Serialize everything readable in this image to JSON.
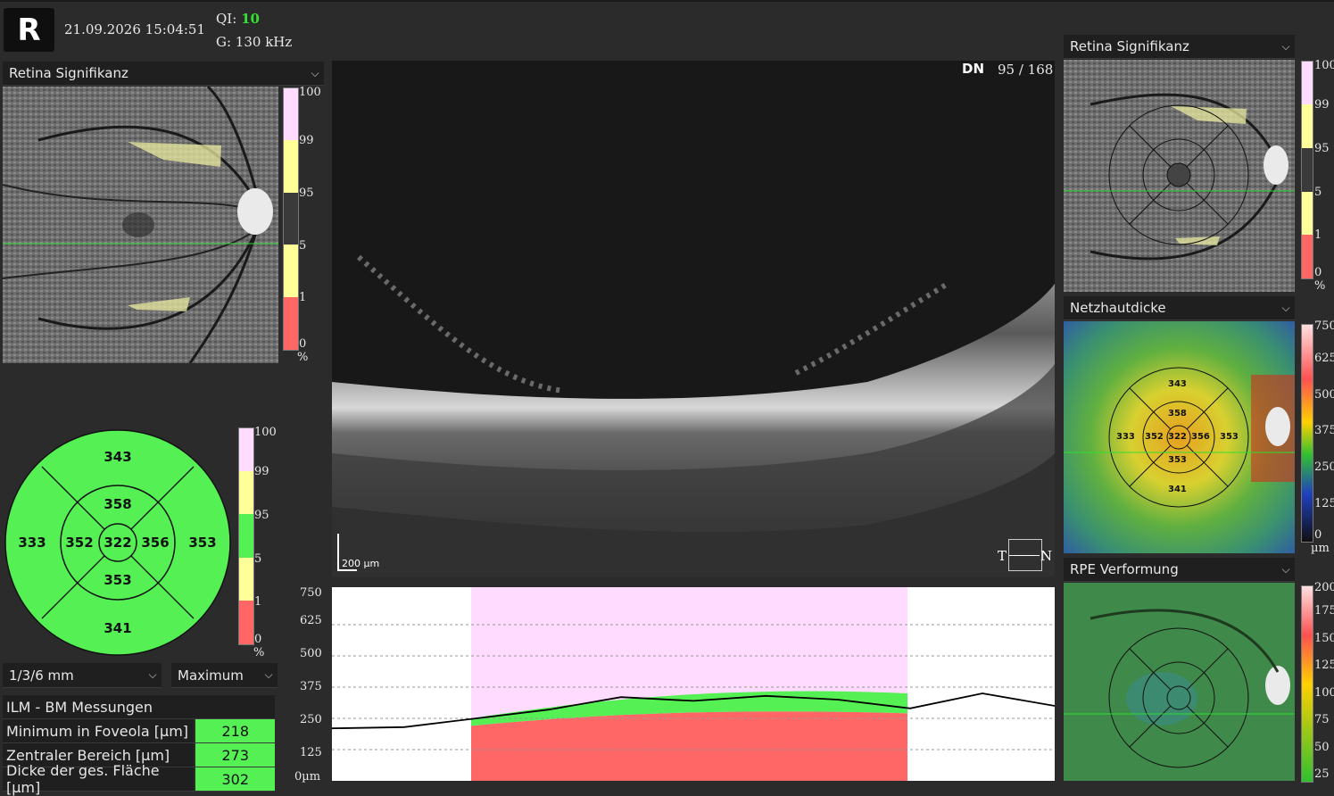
{
  "header": {
    "eye": "R",
    "datetime": "21.09.2026 15:04:51",
    "qi_label": "QI:",
    "qi_value": "10",
    "g_value": "G: 130 kHz"
  },
  "left_panel": {
    "dropdown": "Retina Signifikanz",
    "scale_ticks": [
      "100",
      "99",
      "95",
      "5",
      "1",
      "0"
    ],
    "unit": "%"
  },
  "etdrs_left": {
    "outer_top": "343",
    "outer_left": "333",
    "outer_right": "353",
    "outer_bottom": "341",
    "inner_top": "358",
    "inner_left": "352",
    "center": "322",
    "inner_right": "356",
    "inner_bottom": "353",
    "scale_ticks": [
      "100",
      "99",
      "95",
      "5",
      "1",
      "0"
    ],
    "unit": "%"
  },
  "controls": {
    "grid_select": "1/3/6 mm",
    "mode_select": "Maximum"
  },
  "measurements": {
    "title": "ILM - BM Messungen",
    "rows": [
      {
        "label": "Minimum in Foveola [µm]",
        "value": "218"
      },
      {
        "label": "Zentraler Bereich [µm]",
        "value": "273"
      },
      {
        "label": "Dicke der ges. Fläche [µm]",
        "value": "302"
      }
    ]
  },
  "bscan": {
    "direction": "DN",
    "slice": "95 / 168",
    "scale_label": "200 µm",
    "orient_left": "T",
    "orient_right": "N"
  },
  "profile_chart": {
    "y_ticks": [
      "750",
      "625",
      "500",
      "375",
      "250",
      "125",
      "0µm"
    ]
  },
  "chart_data": {
    "type": "line",
    "ylim": [
      0,
      750
    ],
    "x": [
      0,
      10,
      20,
      30,
      40,
      50,
      60,
      70,
      80,
      90,
      100
    ],
    "series": [
      {
        "values": [
          210,
          215,
          250,
          285,
          335,
          320,
          340,
          325,
          290,
          350,
          300
        ]
      }
    ]
  },
  "right_panels": [
    {
      "dropdown": "Retina Signifikanz",
      "ticks": [
        "100",
        "99",
        "95",
        "5",
        "1",
        "0"
      ],
      "unit": "%"
    },
    {
      "dropdown": "Netzhautdicke",
      "ticks": [
        "750",
        "625",
        "500",
        "375",
        "250",
        "125",
        "0"
      ],
      "unit": "µm",
      "grid": {
        "outer_top": "343",
        "outer_left": "333",
        "outer_right": "353",
        "outer_bottom": "341",
        "inner_top": "358",
        "inner_left": "352",
        "center": "322",
        "inner_right": "356",
        "inner_bottom": "353"
      }
    },
    {
      "dropdown": "RPE Verformung",
      "ticks": [
        "200",
        "175",
        "150",
        "125",
        "100",
        "75",
        "50",
        "25"
      ]
    }
  ],
  "colors": {
    "green_ok": "#54f054",
    "yellow_borderline": "#ffff99",
    "red_abnormal": "#ff6666",
    "pink_supernormal": "#ffdcff"
  }
}
